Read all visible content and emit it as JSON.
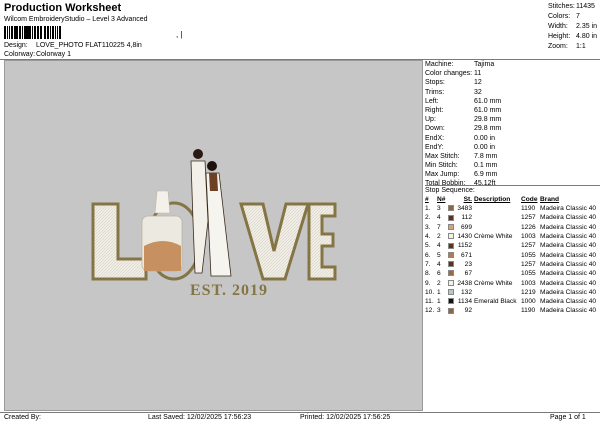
{
  "header": {
    "title": "Production Worksheet",
    "subtitle": "Wilcom EmbroideryStudio – Level 3 Advanced",
    "barcode_tail": ", |",
    "design_label": "Design:",
    "design_value": "LOVE_PHOTO FLAT110225 4,8in",
    "colorway_label": "Colorway:",
    "colorway_value": "Colorway 1"
  },
  "top_stats": [
    {
      "label": "Stitches:",
      "value": "11435"
    },
    {
      "label": "Colors:",
      "value": "7"
    },
    {
      "label": "Width:",
      "value": "2.35 in"
    },
    {
      "label": "Height:",
      "value": "4.80 in"
    },
    {
      "label": "Zoom:",
      "value": "1:1"
    }
  ],
  "machine_info": [
    {
      "label": "Machine:",
      "value": "Tajima"
    },
    {
      "label": "Color changes:",
      "value": "11"
    },
    {
      "label": "Stops:",
      "value": "12"
    },
    {
      "label": "Trims:",
      "value": "32"
    },
    {
      "label": "Left:",
      "value": "61.0 mm"
    },
    {
      "label": "Right:",
      "value": "61.0 mm"
    },
    {
      "label": "Up:",
      "value": "29.8 mm"
    },
    {
      "label": "Down:",
      "value": "29.8 mm"
    },
    {
      "label": "EndX:",
      "value": "0.00 in"
    },
    {
      "label": "EndY:",
      "value": "0.00 in"
    },
    {
      "label": "Max Stitch:",
      "value": "7.8 mm"
    },
    {
      "label": "Min Stitch:",
      "value": "0.1 mm"
    },
    {
      "label": "Max Jump:",
      "value": "6.9 mm"
    },
    {
      "label": "Total Bobbin:",
      "value": "45.12ft"
    }
  ],
  "stop_sequence": {
    "caption": "Stop Sequence:",
    "headers": {
      "num": "#",
      "n": "N#",
      "st": "St.",
      "desc": "Description",
      "code": "Code",
      "brand": "Brand"
    },
    "rows": [
      {
        "num": "1.",
        "n": "3",
        "color": "#8a6a3c",
        "st": "3483",
        "desc": "",
        "code": "1190",
        "brand": "Madeira Classic 40"
      },
      {
        "num": "2.",
        "n": "4",
        "color": "#5a3220",
        "st": "112",
        "desc": "",
        "code": "1257",
        "brand": "Madeira Classic 40"
      },
      {
        "num": "3.",
        "n": "7",
        "color": "#d9a37a",
        "st": "699",
        "desc": "",
        "code": "1226",
        "brand": "Madeira Classic 40"
      },
      {
        "num": "4.",
        "n": "2",
        "color": "#f4f1e8",
        "st": "1430",
        "desc": "Crème White",
        "code": "1003",
        "brand": "Madeira Classic 40"
      },
      {
        "num": "5.",
        "n": "4",
        "color": "#5a3220",
        "st": "1152",
        "desc": "",
        "code": "1257",
        "brand": "Madeira Classic 40"
      },
      {
        "num": "6.",
        "n": "5",
        "color": "#b67a4a",
        "st": "671",
        "desc": "",
        "code": "1055",
        "brand": "Madeira Classic 40"
      },
      {
        "num": "7.",
        "n": "4",
        "color": "#5a3220",
        "st": "23",
        "desc": "",
        "code": "1257",
        "brand": "Madeira Classic 40"
      },
      {
        "num": "8.",
        "n": "6",
        "color": "#9a6a40",
        "st": "67",
        "desc": "",
        "code": "1055",
        "brand": "Madeira Classic 40"
      },
      {
        "num": "9.",
        "n": "2",
        "color": "#f4f1e8",
        "st": "2438",
        "desc": "Crème White",
        "code": "1003",
        "brand": "Madeira Classic 40"
      },
      {
        "num": "10.",
        "n": "1",
        "color": "#b9c6cc",
        "st": "132",
        "desc": "",
        "code": "1219",
        "brand": "Madeira Classic 40"
      },
      {
        "num": "11.",
        "n": "1",
        "color": "#111111",
        "st": "1134",
        "desc": "Emerald Black",
        "code": "1000",
        "brand": "Madeira Classic 40"
      },
      {
        "num": "12.",
        "n": "3",
        "color": "#8a6a3c",
        "st": "92",
        "desc": "",
        "code": "1190",
        "brand": "Madeira Classic 40"
      }
    ]
  },
  "design_preview": {
    "word": "LOVE",
    "est_text": "EST. 2019",
    "outline_color": "#857544",
    "fill_color": "#f1eee7"
  },
  "footer": {
    "created_by": "Created By:",
    "last_saved": "Last Saved: 12/02/2025 17:56:23",
    "printed": "Printed: 12/02/2025 17:56:25",
    "page": "Page 1 of 1"
  }
}
